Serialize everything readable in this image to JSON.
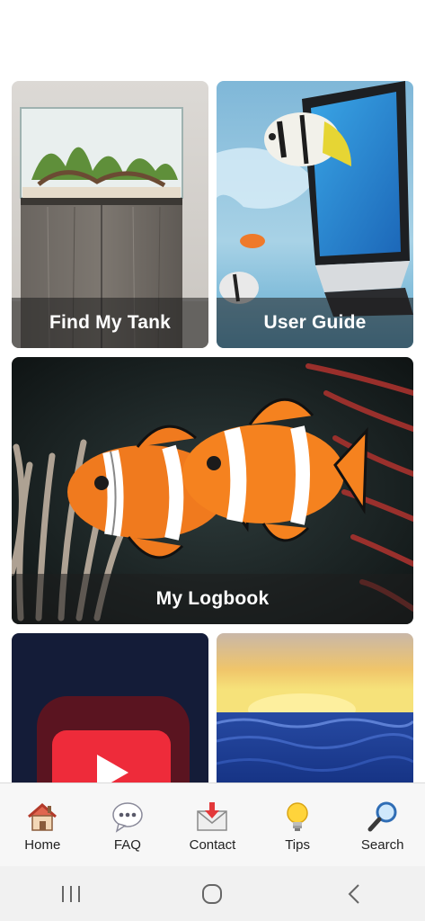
{
  "tiles": {
    "find_my_tank": {
      "label": "Find My Tank"
    },
    "user_guide": {
      "label": "User Guide"
    },
    "my_logbook": {
      "label": "My Logbook"
    }
  },
  "tab_bar": {
    "items": [
      {
        "label": "Home",
        "icon": "home-icon"
      },
      {
        "label": "FAQ",
        "icon": "speech-bubble-icon"
      },
      {
        "label": "Contact",
        "icon": "envelope-icon"
      },
      {
        "label": "Tips",
        "icon": "lightbulb-icon"
      },
      {
        "label": "Search",
        "icon": "magnifier-icon"
      }
    ]
  },
  "system_nav": {
    "buttons": [
      "recent-apps-icon",
      "home-circle-icon",
      "back-chevron-icon"
    ]
  },
  "colors": {
    "caption_overlay": "#1e1e1e",
    "tab_bar_bg": "#f7f7f7",
    "nav_bar_bg": "#f1f1f1"
  }
}
